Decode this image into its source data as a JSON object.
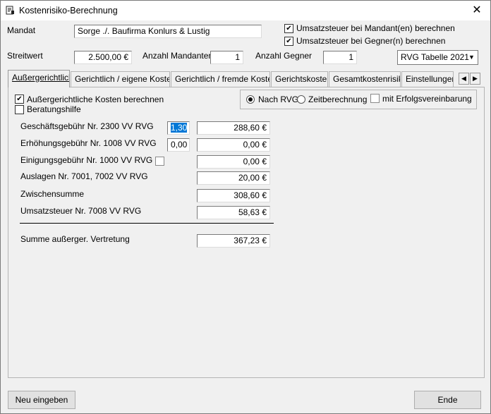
{
  "window": {
    "title": "Kostenrisiko-Berechnung",
    "close_glyph": "✕"
  },
  "header": {
    "mandat_label": "Mandat",
    "mandat_value": "Sorge ./. Baufirma Konlurs & Lustig",
    "ust_mandant_label": "Umsatzsteuer bei Mandant(en) berechnen",
    "ust_mandant_checked": true,
    "ust_gegner_label": "Umsatzsteuer bei Gegner(n) berechnen",
    "ust_gegner_checked": true,
    "streitwert_label": "Streitwert",
    "streitwert_value": "2.500,00  €",
    "anzahl_mandanten_label": "Anzahl Mandanten",
    "anzahl_mandanten_value": "1",
    "anzahl_gegner_label": "Anzahl Gegner",
    "anzahl_gegner_value": "1",
    "rvg_table_value": "RVG Tabelle 2021"
  },
  "tabs": [
    {
      "label": "Außergerichtlich",
      "active": true
    },
    {
      "label": "Gerichtlich / eigene Kosten",
      "active": false
    },
    {
      "label": "Gerichtlich / fremde Kosten",
      "active": false
    },
    {
      "label": "Gerichtskosten",
      "active": false
    },
    {
      "label": "Gesamtkostenrisiko",
      "active": false
    },
    {
      "label": "Einstellungen",
      "active": false
    }
  ],
  "panel": {
    "aussergerichtlich_label": "Außergerichtliche Kosten berechnen",
    "aussergerichtlich_checked": true,
    "beratungshilfe_label": "Beratungshilfe",
    "beratungshilfe_checked": false,
    "nach_rvg_label": "Nach RVG",
    "zeitberechnung_label": "Zeitberechnung",
    "erfolg_label": "mit Erfolgsvereinbarung",
    "rows": [
      {
        "label": "Geschäftsgebühr Nr. 2300 VV RVG",
        "factor": "1,30",
        "amount": "288,60  €"
      },
      {
        "label": "Erhöhungsgebühr Nr. 1008 VV RVG",
        "factor": "0,00",
        "amount": "0,00  €"
      },
      {
        "label": "Einigungsgebühr Nr. 1000 VV RVG",
        "amount": "0,00  €"
      },
      {
        "label": "Auslagen Nr. 7001, 7002 VV RVG",
        "amount": "20,00  €"
      },
      {
        "label": "Zwischensumme",
        "amount": "308,60  €"
      },
      {
        "label": "Umsatzsteuer Nr. 7008 VV RVG",
        "amount": "58,63  €"
      }
    ],
    "summe_label": "Summe außerger. Vertretung",
    "summe_value": "367,23  €"
  },
  "buttons": {
    "neu": "Neu eingeben",
    "ende": "Ende"
  }
}
